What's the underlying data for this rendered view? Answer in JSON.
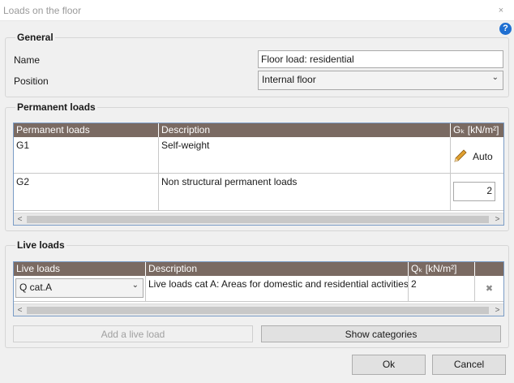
{
  "window": {
    "title": "Loads on the floor",
    "close_glyph": "×"
  },
  "help_glyph": "?",
  "general": {
    "title": "General",
    "name_label": "Name",
    "name_value": "Floor load: residential",
    "position_label": "Position",
    "position_value": "Internal floor"
  },
  "permanent": {
    "title": "Permanent loads",
    "columns": [
      "Permanent loads",
      "Description",
      "Gₖ [kN/m²]"
    ],
    "rows": [
      {
        "name": "G1",
        "description": "Self-weight",
        "value": "Auto",
        "icon": "pencil-icon"
      },
      {
        "name": "G2",
        "description": "Non structural permanent loads",
        "value": "2"
      }
    ]
  },
  "live": {
    "title": "Live loads",
    "columns": [
      "Live loads",
      "Description",
      "Qₖ [kN/m²]",
      ""
    ],
    "rows": [
      {
        "category": "Q cat.A",
        "description": "Live loads cat A: Areas for domestic and residential activities",
        "value": "2",
        "delete_glyph": "✖"
      }
    ],
    "add_button": "Add a live load",
    "categories_button": "Show categories"
  },
  "footer": {
    "ok": "Ok",
    "cancel": "Cancel"
  },
  "scroll_arrows": {
    "left": "<",
    "right": ">"
  },
  "colors": {
    "header_bg": "#7a6a62",
    "grid_border": "#7a9cc6",
    "help_blue": "#1f6fd1"
  }
}
